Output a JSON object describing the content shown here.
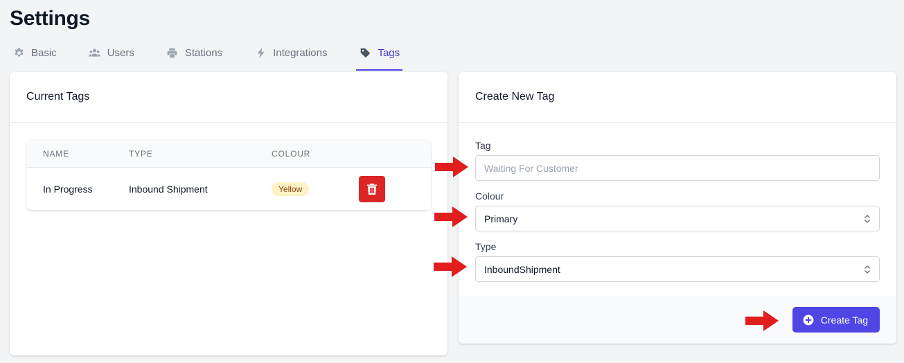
{
  "page": {
    "title": "Settings"
  },
  "tabs": [
    {
      "label": "Basic",
      "icon": "gear-icon"
    },
    {
      "label": "Users",
      "icon": "users-icon"
    },
    {
      "label": "Stations",
      "icon": "printer-icon"
    },
    {
      "label": "Integrations",
      "icon": "bolt-icon"
    },
    {
      "label": "Tags",
      "icon": "tag-icon",
      "active": true
    }
  ],
  "current_tags": {
    "title": "Current Tags",
    "columns": [
      "NAME",
      "TYPE",
      "COLOUR"
    ],
    "rows": [
      {
        "name": "In Progress",
        "type": "Inbound Shipment",
        "colour": "Yellow"
      }
    ]
  },
  "create_tag": {
    "title": "Create New Tag",
    "tag_label": "Tag",
    "tag_placeholder": "Waiting For Customer",
    "tag_value": "",
    "colour_label": "Colour",
    "colour_value": "Primary",
    "type_label": "Type",
    "type_value": "InboundShipment",
    "submit_label": "Create Tag"
  },
  "colors": {
    "accent": "#4f46e5",
    "danger": "#dc2626",
    "badge_yellow_bg": "#fef3c7",
    "badge_yellow_text": "#92400e",
    "annotation_arrow": "#e11d1d"
  }
}
